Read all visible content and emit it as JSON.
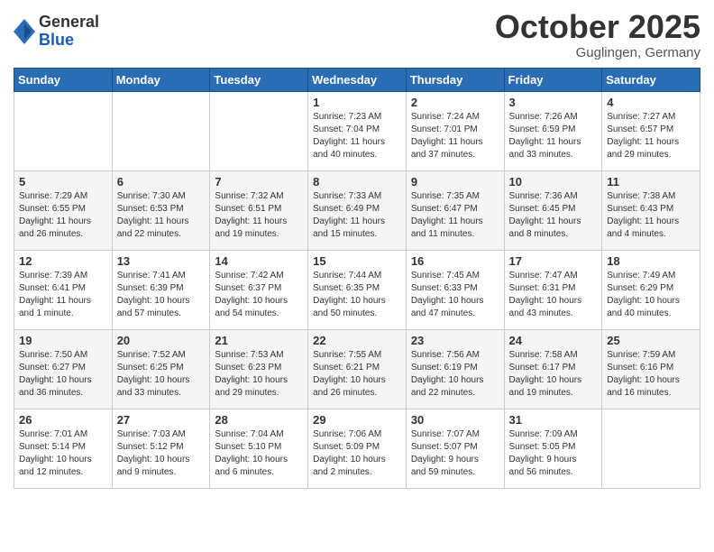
{
  "header": {
    "logo_general": "General",
    "logo_blue": "Blue",
    "month_title": "October 2025",
    "subtitle": "Guglingen, Germany"
  },
  "weekdays": [
    "Sunday",
    "Monday",
    "Tuesday",
    "Wednesday",
    "Thursday",
    "Friday",
    "Saturday"
  ],
  "weeks": [
    [
      {
        "num": "",
        "info": ""
      },
      {
        "num": "",
        "info": ""
      },
      {
        "num": "",
        "info": ""
      },
      {
        "num": "1",
        "info": "Sunrise: 7:23 AM\nSunset: 7:04 PM\nDaylight: 11 hours\nand 40 minutes."
      },
      {
        "num": "2",
        "info": "Sunrise: 7:24 AM\nSunset: 7:01 PM\nDaylight: 11 hours\nand 37 minutes."
      },
      {
        "num": "3",
        "info": "Sunrise: 7:26 AM\nSunset: 6:59 PM\nDaylight: 11 hours\nand 33 minutes."
      },
      {
        "num": "4",
        "info": "Sunrise: 7:27 AM\nSunset: 6:57 PM\nDaylight: 11 hours\nand 29 minutes."
      }
    ],
    [
      {
        "num": "5",
        "info": "Sunrise: 7:29 AM\nSunset: 6:55 PM\nDaylight: 11 hours\nand 26 minutes."
      },
      {
        "num": "6",
        "info": "Sunrise: 7:30 AM\nSunset: 6:53 PM\nDaylight: 11 hours\nand 22 minutes."
      },
      {
        "num": "7",
        "info": "Sunrise: 7:32 AM\nSunset: 6:51 PM\nDaylight: 11 hours\nand 19 minutes."
      },
      {
        "num": "8",
        "info": "Sunrise: 7:33 AM\nSunset: 6:49 PM\nDaylight: 11 hours\nand 15 minutes."
      },
      {
        "num": "9",
        "info": "Sunrise: 7:35 AM\nSunset: 6:47 PM\nDaylight: 11 hours\nand 11 minutes."
      },
      {
        "num": "10",
        "info": "Sunrise: 7:36 AM\nSunset: 6:45 PM\nDaylight: 11 hours\nand 8 minutes."
      },
      {
        "num": "11",
        "info": "Sunrise: 7:38 AM\nSunset: 6:43 PM\nDaylight: 11 hours\nand 4 minutes."
      }
    ],
    [
      {
        "num": "12",
        "info": "Sunrise: 7:39 AM\nSunset: 6:41 PM\nDaylight: 11 hours\nand 1 minute."
      },
      {
        "num": "13",
        "info": "Sunrise: 7:41 AM\nSunset: 6:39 PM\nDaylight: 10 hours\nand 57 minutes."
      },
      {
        "num": "14",
        "info": "Sunrise: 7:42 AM\nSunset: 6:37 PM\nDaylight: 10 hours\nand 54 minutes."
      },
      {
        "num": "15",
        "info": "Sunrise: 7:44 AM\nSunset: 6:35 PM\nDaylight: 10 hours\nand 50 minutes."
      },
      {
        "num": "16",
        "info": "Sunrise: 7:45 AM\nSunset: 6:33 PM\nDaylight: 10 hours\nand 47 minutes."
      },
      {
        "num": "17",
        "info": "Sunrise: 7:47 AM\nSunset: 6:31 PM\nDaylight: 10 hours\nand 43 minutes."
      },
      {
        "num": "18",
        "info": "Sunrise: 7:49 AM\nSunset: 6:29 PM\nDaylight: 10 hours\nand 40 minutes."
      }
    ],
    [
      {
        "num": "19",
        "info": "Sunrise: 7:50 AM\nSunset: 6:27 PM\nDaylight: 10 hours\nand 36 minutes."
      },
      {
        "num": "20",
        "info": "Sunrise: 7:52 AM\nSunset: 6:25 PM\nDaylight: 10 hours\nand 33 minutes."
      },
      {
        "num": "21",
        "info": "Sunrise: 7:53 AM\nSunset: 6:23 PM\nDaylight: 10 hours\nand 29 minutes."
      },
      {
        "num": "22",
        "info": "Sunrise: 7:55 AM\nSunset: 6:21 PM\nDaylight: 10 hours\nand 26 minutes."
      },
      {
        "num": "23",
        "info": "Sunrise: 7:56 AM\nSunset: 6:19 PM\nDaylight: 10 hours\nand 22 minutes."
      },
      {
        "num": "24",
        "info": "Sunrise: 7:58 AM\nSunset: 6:17 PM\nDaylight: 10 hours\nand 19 minutes."
      },
      {
        "num": "25",
        "info": "Sunrise: 7:59 AM\nSunset: 6:16 PM\nDaylight: 10 hours\nand 16 minutes."
      }
    ],
    [
      {
        "num": "26",
        "info": "Sunrise: 7:01 AM\nSunset: 5:14 PM\nDaylight: 10 hours\nand 12 minutes."
      },
      {
        "num": "27",
        "info": "Sunrise: 7:03 AM\nSunset: 5:12 PM\nDaylight: 10 hours\nand 9 minutes."
      },
      {
        "num": "28",
        "info": "Sunrise: 7:04 AM\nSunset: 5:10 PM\nDaylight: 10 hours\nand 6 minutes."
      },
      {
        "num": "29",
        "info": "Sunrise: 7:06 AM\nSunset: 5:09 PM\nDaylight: 10 hours\nand 2 minutes."
      },
      {
        "num": "30",
        "info": "Sunrise: 7:07 AM\nSunset: 5:07 PM\nDaylight: 9 hours\nand 59 minutes."
      },
      {
        "num": "31",
        "info": "Sunrise: 7:09 AM\nSunset: 5:05 PM\nDaylight: 9 hours\nand 56 minutes."
      },
      {
        "num": "",
        "info": ""
      }
    ]
  ]
}
